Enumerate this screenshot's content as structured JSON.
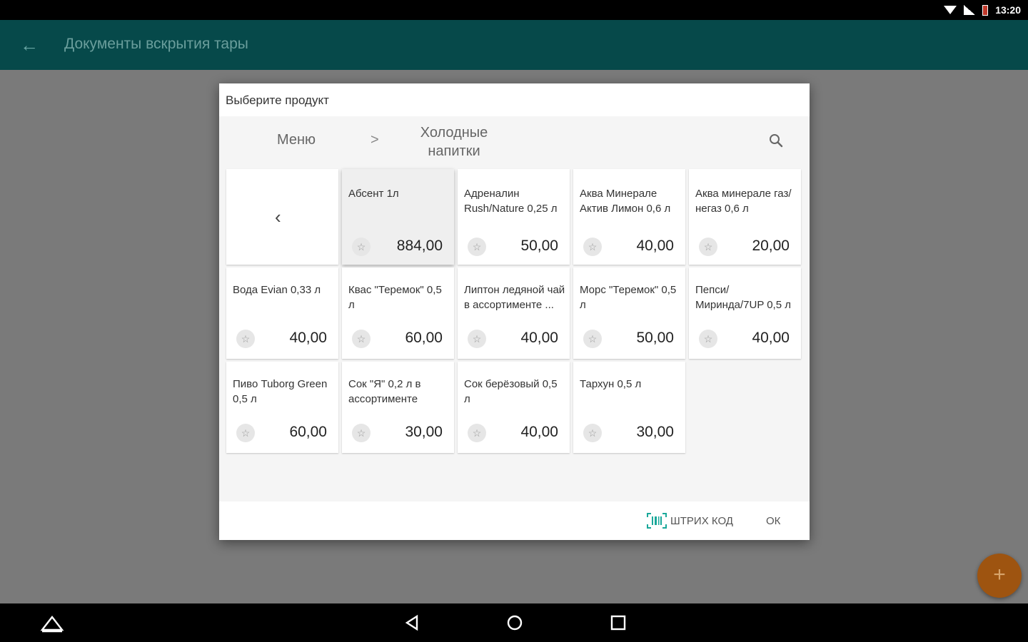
{
  "statusbar": {
    "time": "13:20"
  },
  "appbar": {
    "back_icon": "arrow-left-icon",
    "title": "Документы вскрытия тары"
  },
  "dialog": {
    "title": "Выберите продукт",
    "breadcrumb": {
      "root": "Меню",
      "separator": ">",
      "current": "Холодные напитки"
    },
    "search_icon": "search-icon",
    "back_tile_icon": "chevron-left-icon",
    "products": [
      {
        "name": "Абсент 1л",
        "price": "884,00",
        "selected": true
      },
      {
        "name": "Адреналин Rush/Nature 0,25 л",
        "price": "50,00"
      },
      {
        "name": "Аква Минерале Актив Лимон 0,6 л",
        "price": "40,00"
      },
      {
        "name": "Аква минерале газ/негаз 0,6 л",
        "price": "20,00"
      },
      {
        "name": "Вода Evian 0,33 л",
        "price": "40,00"
      },
      {
        "name": "Квас \"Теремок\" 0,5 л",
        "price": "60,00"
      },
      {
        "name": "Липтон ледяной чай в ассортименте ...",
        "price": "40,00"
      },
      {
        "name": "Морс \"Теремок\" 0,5 л",
        "price": "50,00"
      },
      {
        "name": "Пепси/ Миринда/7UP 0,5 л",
        "price": "40,00"
      },
      {
        "name": "Пиво Tuborg Green 0,5 л",
        "price": "60,00"
      },
      {
        "name": "Сок \"Я\" 0,2 л в ассортименте",
        "price": "30,00"
      },
      {
        "name": "Сок берёзовый 0,5 л",
        "price": "40,00"
      },
      {
        "name": "Тархун 0,5 л",
        "price": "30,00"
      }
    ],
    "footer": {
      "barcode_label": "ШТРИХ КОД",
      "ok_label": "ОК"
    }
  },
  "fab": {
    "label": "+"
  },
  "colors": {
    "appbar": "#06494a",
    "fab": "#9e5410",
    "accent": "#1aa89a"
  }
}
